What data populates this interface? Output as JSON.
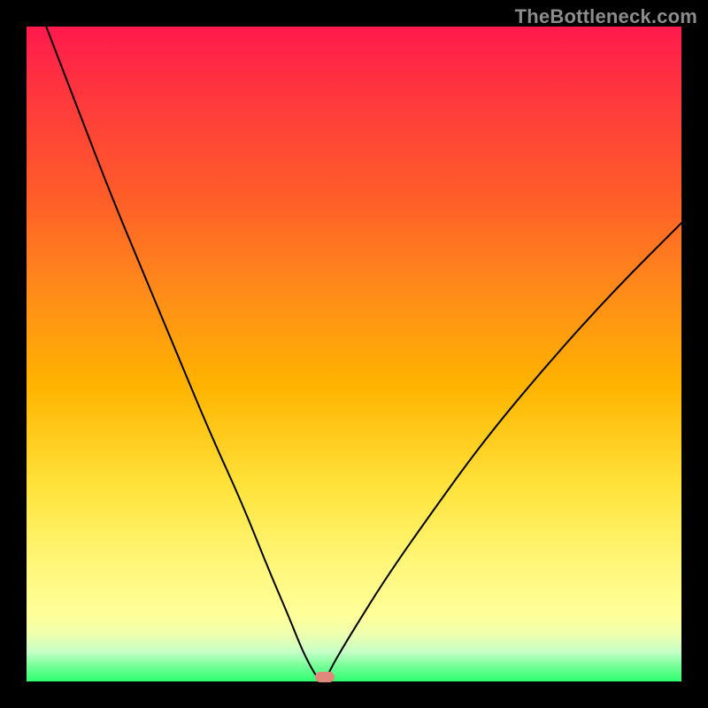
{
  "watermark": "TheBottleneck.com",
  "chart_data": {
    "type": "line",
    "title": "",
    "xlabel": "",
    "ylabel": "",
    "xlim": [
      0,
      100
    ],
    "ylim": [
      0,
      100
    ],
    "grid": false,
    "legend": false,
    "background_gradient": {
      "top": "#ff1a4d",
      "bottom": "#2dff70",
      "meaning_top": "high bottleneck",
      "meaning_bottom": "no bottleneck"
    },
    "series": [
      {
        "name": "bottleneck-curve",
        "x": [
          3,
          8,
          13,
          18,
          23,
          28,
          33,
          37,
          40,
          42,
          43.5,
          44.5,
          45.5,
          47,
          50,
          55,
          62,
          70,
          80,
          90,
          100
        ],
        "values": [
          100,
          87,
          74,
          62,
          50,
          38,
          27,
          17,
          10,
          5,
          2,
          0.5,
          0,
          3,
          8,
          16,
          26,
          37,
          49,
          60,
          70
        ]
      }
    ],
    "optimal_point": {
      "x": 45.5,
      "y": 0
    }
  },
  "colors": {
    "curve": "#000000",
    "marker": "#e0897a",
    "frame": "#000000"
  }
}
